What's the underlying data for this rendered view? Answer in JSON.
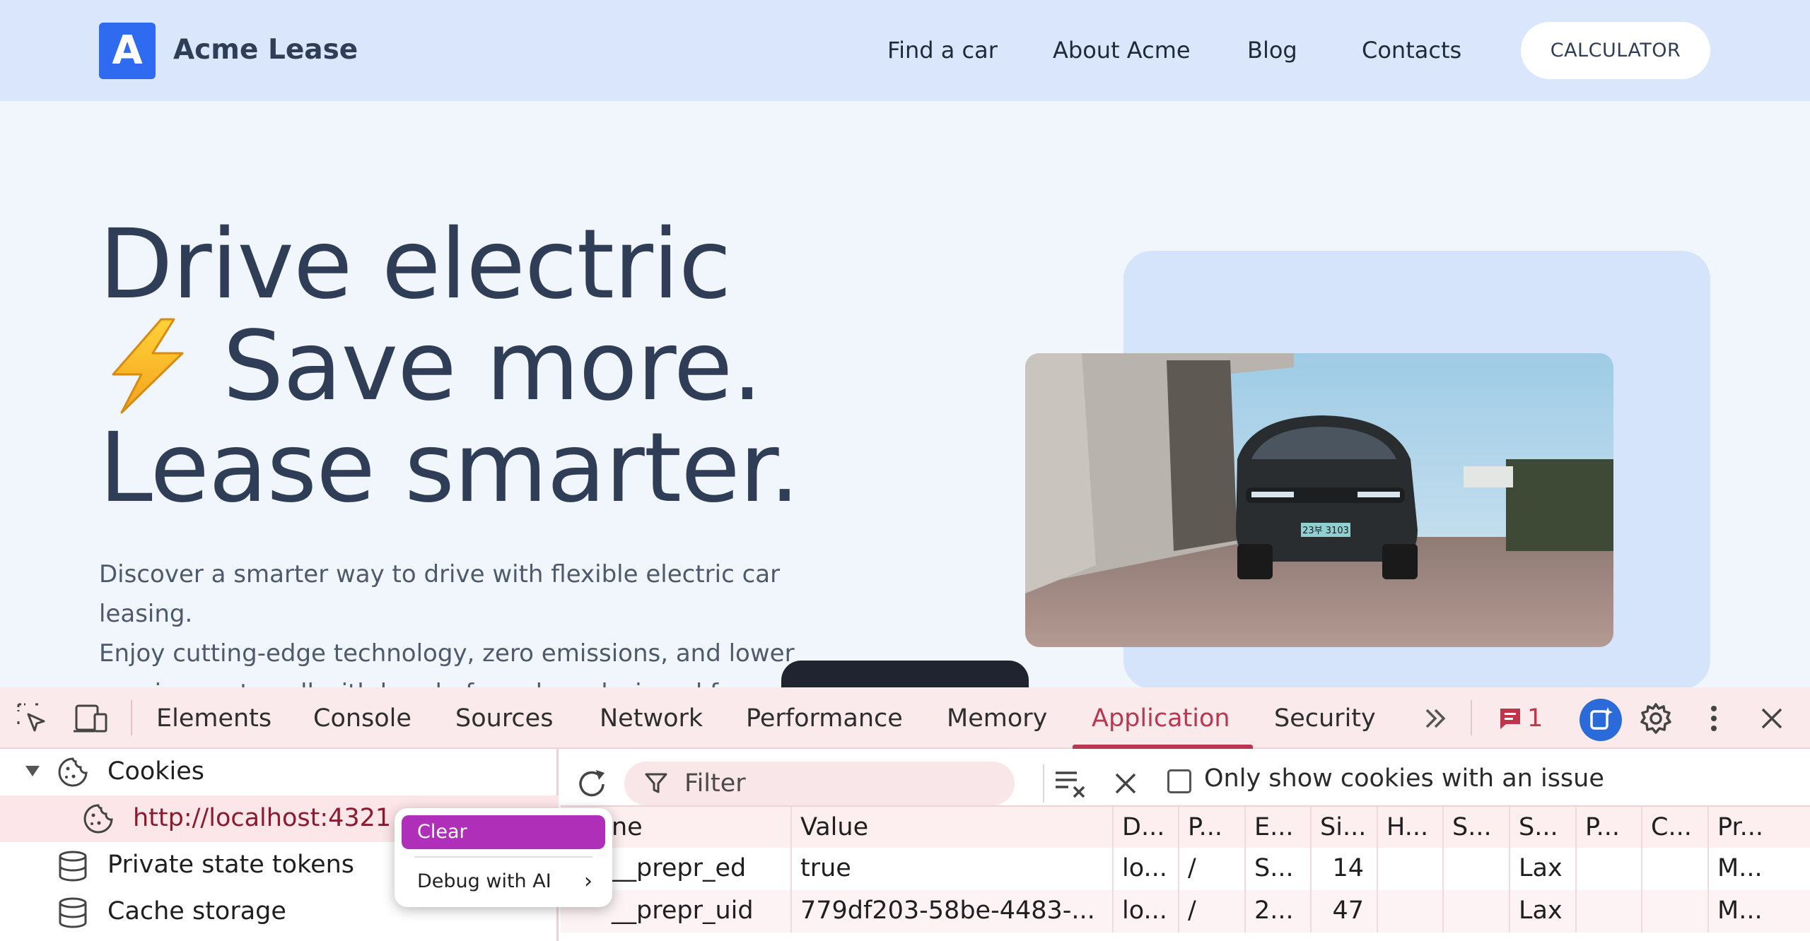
{
  "site": {
    "logo_letter": "A",
    "brand": "Acme Lease",
    "nav": [
      "Find a car",
      "About Acme",
      "Blog",
      "Contacts"
    ],
    "cta": "CALCULATOR",
    "colors": {
      "header_bg": "#d9e6fb",
      "logo_bg": "#2f6bf0",
      "text": "#2f3e56"
    }
  },
  "hero": {
    "line1": "Drive electric",
    "line2": "Save more.",
    "line3": "Lease smarter.",
    "bolt_icon": "lightning-bolt-emoji",
    "description": [
      "Discover a smarter way to drive with flexible electric car leasing.",
      "Enjoy cutting-edge technology, zero emissions, and lower",
      "running costs—all with hassle-free plans designed for you."
    ],
    "car_plate": "23부 3103"
  },
  "devtools": {
    "tabs": [
      "Elements",
      "Console",
      "Sources",
      "Network",
      "Performance",
      "Memory",
      "Application",
      "Security"
    ],
    "active_tab": "Application",
    "more_tabs_icon": "double-chevron-right-icon",
    "issues_count": "1",
    "accent": "#b9384f",
    "sidebar": {
      "cookies_label": "Cookies",
      "cookie_origin": "http://localhost:4321",
      "private_state_tokens": "Private state tokens",
      "cache_storage": "Cache storage"
    },
    "toolbar": {
      "filter_placeholder": "Filter",
      "only_issues_label": "Only show cookies with an issue",
      "only_issues_checked": false
    },
    "table": {
      "headers": [
        "ne",
        "Value",
        "D...",
        "P...",
        "E...",
        "Si...",
        "H...",
        "S...",
        "S...",
        "P...",
        "C...",
        "Pr..."
      ],
      "rows": [
        [
          "__prepr_ed",
          "true",
          "lo...",
          "/",
          "S...",
          "14",
          "",
          "",
          "Lax",
          "",
          "",
          "M..."
        ],
        [
          "__prepr_uid",
          "779df203-58be-4483-...",
          "lo...",
          "/",
          "2...",
          "47",
          "",
          "",
          "Lax",
          "",
          "",
          "M..."
        ]
      ]
    },
    "context_menu": {
      "clear": "Clear",
      "debug": "Debug with AI",
      "highlight": "#b02fb8"
    }
  }
}
